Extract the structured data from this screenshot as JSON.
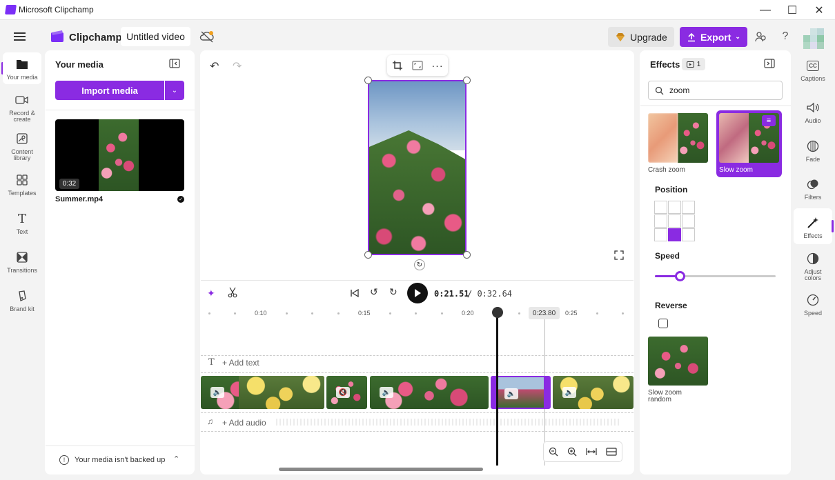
{
  "window": {
    "title": "Microsoft Clipchamp"
  },
  "header": {
    "brand": "Clipchamp",
    "project_title": "Untitled video",
    "upgrade_label": "Upgrade",
    "export_label": "Export",
    "accent": "#8a2be2"
  },
  "left_rail": [
    {
      "label": "Your media",
      "icon": "folder-icon"
    },
    {
      "label": "Record & create",
      "icon": "camera-icon"
    },
    {
      "label": "Content library",
      "icon": "library-icon"
    },
    {
      "label": "Templates",
      "icon": "templates-icon"
    },
    {
      "label": "Text",
      "icon": "text-icon"
    },
    {
      "label": "Transitions",
      "icon": "transitions-icon"
    },
    {
      "label": "Brand kit",
      "icon": "brand-kit-icon"
    }
  ],
  "media_panel": {
    "title": "Your media",
    "import_label": "Import media",
    "item": {
      "duration": "0:32",
      "filename": "Summer.mp4"
    },
    "backup_notice": "Your media isn't backed up"
  },
  "timeline": {
    "current_time": "0:21.51",
    "total_time": "/ 0:32.64",
    "playhead_time": "0:23.80",
    "ruler": [
      "0:10",
      "0:15",
      "0:20",
      "0:25"
    ],
    "add_text": "+ Add text",
    "add_audio": "+ Add audio"
  },
  "effects_panel": {
    "title": "Effects",
    "count": "1",
    "search_value": "zoom",
    "effects": [
      {
        "name": "Crash zoom",
        "selected": false
      },
      {
        "name": "Slow zoom",
        "selected": true
      },
      {
        "name": "Slow zoom random",
        "selected": false
      }
    ],
    "position_label": "Position",
    "position_selected": "bottom-center",
    "speed_label": "Speed",
    "speed_value": 0.2,
    "reverse_label": "Reverse",
    "reverse_checked": false
  },
  "right_rail": [
    {
      "label": "Captions",
      "icon": "captions-icon"
    },
    {
      "label": "Audio",
      "icon": "audio-icon"
    },
    {
      "label": "Fade",
      "icon": "fade-icon"
    },
    {
      "label": "Filters",
      "icon": "filters-icon"
    },
    {
      "label": "Effects",
      "icon": "effects-icon"
    },
    {
      "label": "Adjust colors",
      "icon": "adjust-colors-icon"
    },
    {
      "label": "Speed",
      "icon": "speed-icon"
    }
  ]
}
